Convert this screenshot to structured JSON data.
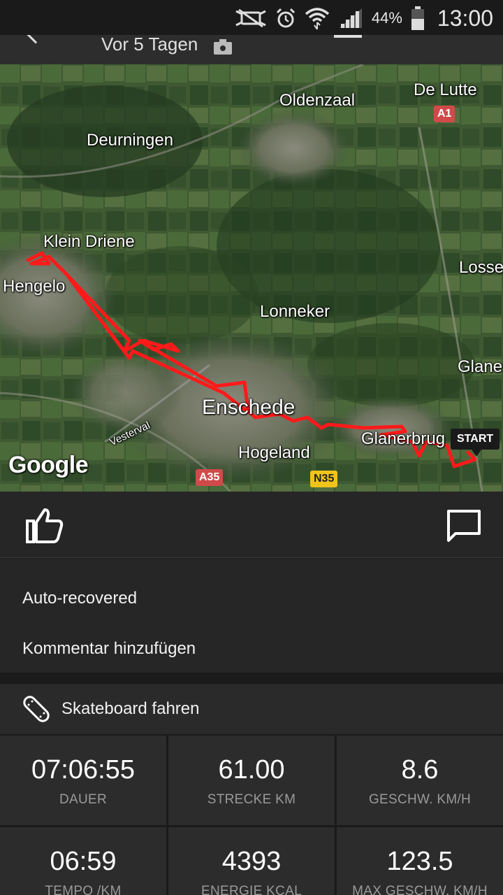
{
  "status_bar": {
    "battery_percent": "44%",
    "time": "13:00",
    "icons": [
      "mute-icon",
      "alarm-icon",
      "wifi-icon",
      "signal-icon",
      "battery-icon"
    ]
  },
  "header": {
    "date_text": "Vor 5 Tagen",
    "icon": "camera-icon"
  },
  "map": {
    "labels": {
      "oldenzaal": "Oldenzaal",
      "de_lutte": "De Lutte",
      "deurningen": "Deurningen",
      "klein_driene": "Klein Driene",
      "hengelo": "Hengelo",
      "losser": "Losse",
      "lonneker": "Lonneker",
      "glane": "Glane",
      "enschede": "Enschede",
      "glanerbrug": "Glanerbrug",
      "hogeland": "Hogeland",
      "vesterval": "Vesterval"
    },
    "roads": {
      "a1": "A1",
      "a35": "A35",
      "n35": "N35"
    },
    "start_marker": "START",
    "attribution": "Google",
    "route_color": "#ff1a1a"
  },
  "actions": {
    "like_icon": "thumbs-up-icon",
    "comment_icon": "comment-icon"
  },
  "notes": {
    "auto_recovered": "Auto-recovered",
    "add_comment": "Kommentar hinzufügen"
  },
  "activity": {
    "icon": "skateboard-icon",
    "label": "Skateboard fahren"
  },
  "stats": {
    "duration": {
      "value": "07:06:55",
      "label": "DAUER"
    },
    "distance": {
      "value": "61.00",
      "label": "STRECKE KM"
    },
    "speed": {
      "value": "8.6",
      "label": "GESCHW. KM/H"
    },
    "pace": {
      "value": "06:59",
      "label": "TEMPO /KM"
    },
    "energy": {
      "value": "4393",
      "label": "ENERGIE KCAL"
    },
    "max_speed": {
      "value": "123.5",
      "label": "MAX GESCHW. KM/H"
    }
  }
}
